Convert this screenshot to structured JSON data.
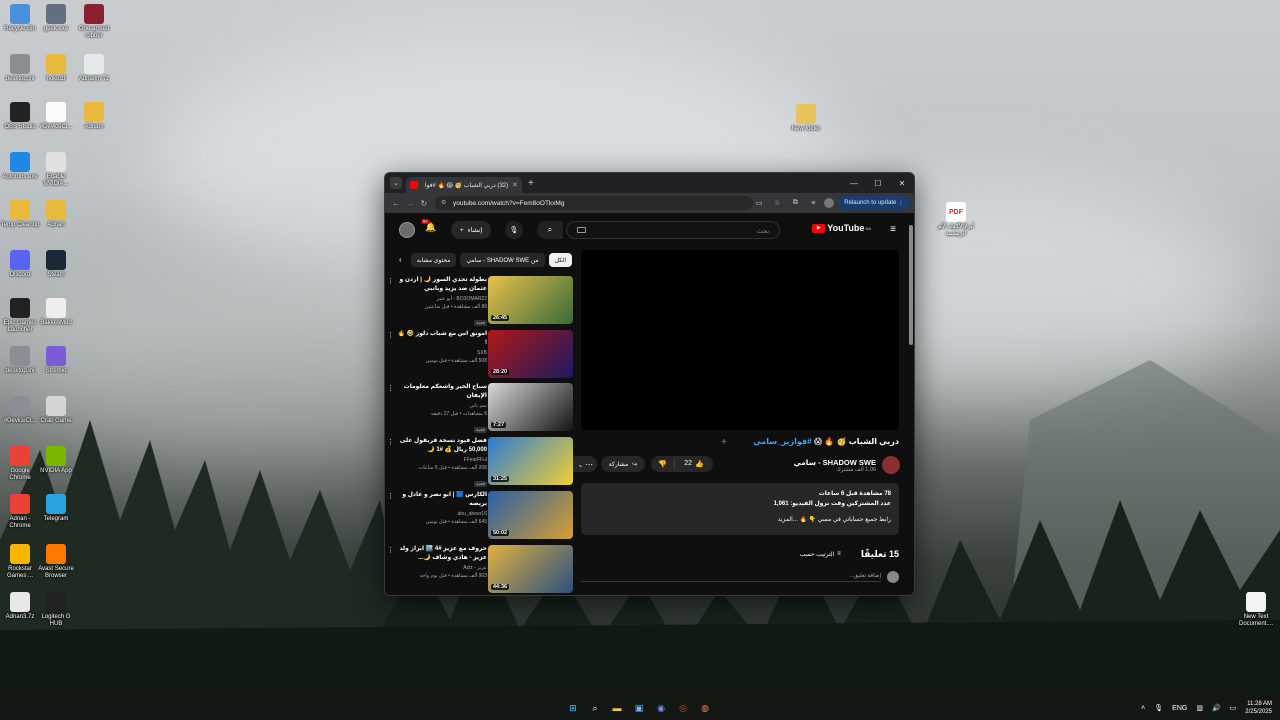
{
  "desktop": {
    "icons_left": [
      {
        "label": "Recycle Bin",
        "icon": "recycle-bin-icon",
        "color": "#4a90d9"
      },
      {
        "label": "geek.exe",
        "icon": "app-icon",
        "color": "#607080"
      },
      {
        "label": "One-armed robber",
        "icon": "game-icon",
        "color": "#8a2030"
      },
      {
        "label": "desktop.ini",
        "icon": "file-icon",
        "color": "#8a8f95"
      },
      {
        "label": "hokuizf",
        "icon": "folder-icon",
        "color": "#e8b93a"
      },
      {
        "label": "Adnanm.7z",
        "icon": "archive-icon",
        "color": "#e8e8e8"
      },
      {
        "label": "OBS Studio",
        "icon": "obs-icon",
        "color": "#222"
      },
      {
        "label": "#DeviceCl...",
        "icon": "devcln-icon",
        "color": "#fafafa"
      },
      {
        "label": "Adnam",
        "icon": "folder-icon",
        "color": "#e8b93a"
      },
      {
        "label": "Autoruns.exe",
        "icon": "autoruns-icon",
        "color": "#1e88e5"
      },
      {
        "label": "Enable NVIDIA...",
        "icon": "settings-icon",
        "color": "#e0e0e0"
      },
      {
        "label": "Temp Cleanup",
        "icon": "folder-icon",
        "color": "#e8b93a"
      },
      {
        "label": "Adnan",
        "icon": "folder-icon",
        "color": "#e8b93a"
      },
      {
        "label": "Discord",
        "icon": "discord-icon",
        "color": "#5865f2"
      },
      {
        "label": "Steam",
        "icon": "steam-icon",
        "color": "#1b2838"
      },
      {
        "label": "Epic Games Launcher",
        "icon": "epic-icon",
        "color": "#222"
      },
      {
        "label": "BakkesMod",
        "icon": "bakkesmod-icon",
        "color": "#eee"
      },
      {
        "label": "desktop.ini",
        "icon": "file-icon",
        "color": "#8a8f95"
      },
      {
        "label": "Stremio",
        "icon": "stremio-icon",
        "color": "#7b5bd6"
      },
      {
        "label": "#DeviceCl...",
        "icon": "file-icon",
        "color": "#8a8f95"
      },
      {
        "label": "Crab Game",
        "icon": "crab-game-icon",
        "color": "#d4d4d4"
      },
      {
        "label": "Google Chrome",
        "icon": "chrome-icon",
        "color": "#ea4335"
      },
      {
        "label": "NVIDIA App",
        "icon": "nvidia-icon",
        "color": "#76b900"
      },
      {
        "label": "Adnan - Chrome",
        "icon": "chrome-icon",
        "color": "#ea4335"
      },
      {
        "label": "Telegram",
        "icon": "telegram-icon",
        "color": "#2aa3df"
      },
      {
        "label": "Rockstar Games ...",
        "icon": "rockstar-icon",
        "color": "#f7b500"
      },
      {
        "label": "Avast Secure Browser",
        "icon": "avast-icon",
        "color": "#ff7800"
      },
      {
        "label": "Adnan3.7z",
        "icon": "archive-icon",
        "color": "#e8e8e8"
      },
      {
        "label": "Logitech G HUB",
        "icon": "logitech-icon",
        "color": "#222"
      }
    ],
    "new_folder": "New folder",
    "pdf_label": "أبزلاالأكواد الأم الرئيسية",
    "new_text": "New Text Document...."
  },
  "browser": {
    "tab_title": "(32) دربي الشباب 🥳 😱 🔥 #فوا",
    "url": "youtube.com/watch?v=Fem8oOTkxMg",
    "relaunch": "Relaunch to update",
    "win_min": "—",
    "win_max": "☐",
    "win_close": "✕"
  },
  "youtube": {
    "logo": "YouTube",
    "region": "SA",
    "search_placeholder": "بحث",
    "create_label": "إنشاء",
    "notif_count": "9+",
    "chips": [
      "الكل",
      "من SHADOW SWE - سامي",
      "محتوى مشابه"
    ],
    "video_title_plain": "دربي الشباب 🥳 🔥 😱 ",
    "video_title_tag": "#فوازير_سامي",
    "channel_name": "SHADOW SWE - سامي",
    "channel_subs": "1.06 ألف مشترك",
    "likes": "22",
    "share": "مشاركة",
    "desc_meta": "78 مشاهدة  قبل 6 ساعات",
    "desc_line2": "عدد المشتركين وقت نزول الفيديو: 1,061",
    "desc_line3": "رابط جميع حساباتي في مسي 👇 🔥  ...المزيد",
    "comments_count": "15 تعليقًا",
    "sort_label": "الترتيب حسب",
    "add_comment": "إضافة تعليق...",
    "recommendations": [
      {
        "title": "بطولة تحدي السور 🌙 | اردن و عثمان ضد يزيد وبانبي",
        "channel": "BO3OMAR22 - أبو عمر",
        "stats": "89 ألف مشاهدة • قبل ساعتين",
        "duration": "26:45",
        "badge": "جديد",
        "c1": "#e8c04a",
        "c2": "#3a6b3a"
      },
      {
        "title": "امونق اس مع شباب دلوز 🤣 🔥 !",
        "channel": "SXB",
        "stats": "508 ألف مشاهدة • قبل يومين",
        "duration": "28:20",
        "badge": "",
        "c1": "#b01818",
        "c2": "#1a1a60"
      },
      {
        "title": "سباح الخير واشعكم معلومات الإيفان",
        "channel": "سم باني",
        "stats": "6 مشاهدات • قبل 27 دقيقة",
        "duration": "7:27",
        "badge": "جديد",
        "c1": "#d9d9d9",
        "c2": "#151515"
      },
      {
        "title": "فضل فيود نسخة فريقول على 50,000 ريال 💰 #1 🌙",
        "channel": "FFearFFul",
        "stats": "208 ألف مشاهدة • قبل 6 ساعات",
        "duration": "31:25",
        "badge": "جديد",
        "c1": "#2d7ad6",
        "c2": "#f0d030"
      },
      {
        "title": "الكارس 🟦 | ابو نصر و عادل و بريصه",
        "channel": "abu_abeer16",
        "stats": "645 ألف مشاهدة • قبل يومين",
        "duration": "50:02",
        "badge": "",
        "c1": "#2a5fa8",
        "c2": "#d6a030"
      },
      {
        "title": "حروف مع عزيز #4 🏙️ ابزاز ولد عزيز - هادي وشاف 🌙...",
        "channel": "عزيز - Aziz",
        "stats": "903 ألف مشاهدة • قبل يوم واحد",
        "duration": "44:36",
        "badge": "",
        "c1": "#e0b040",
        "c2": "#2a5080"
      }
    ]
  },
  "taskbar": {
    "lang": "ENG",
    "time": "11:28 AM",
    "date": "2/25/2025"
  }
}
